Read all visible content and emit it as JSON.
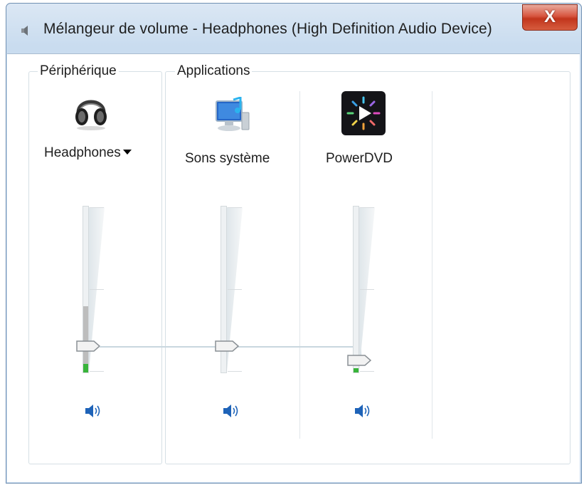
{
  "window": {
    "title": "Mélangeur de volume - Headphones (High Definition Audio Device)",
    "close_label": "X"
  },
  "groups": {
    "device_label": "Périphérique",
    "apps_label": "Applications"
  },
  "channels": [
    {
      "name": "Headphones",
      "icon": "headphones-icon",
      "has_dropdown": true,
      "volume_percent": 16,
      "peak_level_percent": 40,
      "muted": false
    },
    {
      "name": "Sons système",
      "icon": "system-sounds-icon",
      "has_dropdown": false,
      "volume_percent": 16,
      "peak_level_percent": 0,
      "muted": false
    },
    {
      "name": "PowerDVD",
      "icon": "powerdvd-icon",
      "has_dropdown": false,
      "volume_percent": 5,
      "peak_level_percent": 0,
      "muted": false
    }
  ],
  "colors": {
    "accent_blue": "#1e63b8",
    "peak_green": "#38b43a",
    "close_red": "#c2351c"
  }
}
